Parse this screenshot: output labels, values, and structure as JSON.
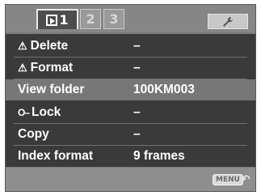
{
  "tabs": [
    {
      "label": "1",
      "icon": "playback-icon",
      "active": true
    },
    {
      "label": "2",
      "active": false
    },
    {
      "label": "3",
      "active": false
    },
    {
      "label": "",
      "icon": "wrench-icon",
      "active": false
    }
  ],
  "menu": {
    "rows": [
      {
        "icon": "warning-icon",
        "label": "Delete",
        "value": "–",
        "selected": false
      },
      {
        "icon": "warning-icon",
        "label": "Format",
        "value": "–",
        "selected": false
      },
      {
        "icon": "",
        "label": "View folder",
        "value": "100KM003",
        "selected": true
      },
      {
        "icon": "key-icon",
        "label": "Lock",
        "value": "–",
        "selected": false
      },
      {
        "icon": "",
        "label": "Copy",
        "value": "–",
        "selected": false
      },
      {
        "icon": "",
        "label": "Index format",
        "value": "9 frames",
        "selected": false
      }
    ]
  },
  "footer": {
    "menu_button": "MENU",
    "return_icon": "return-arrow-icon"
  }
}
